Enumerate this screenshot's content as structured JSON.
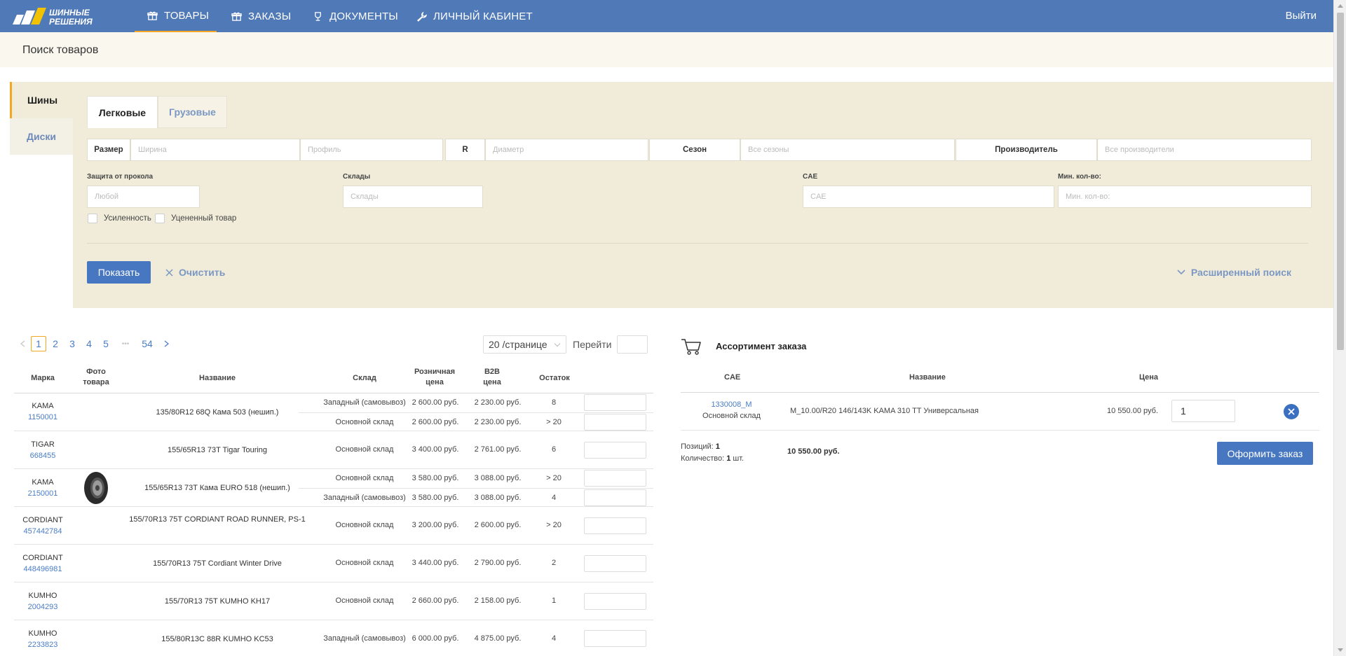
{
  "nav": {
    "logo_text": "ШИННЫЕ РЕШЕНИЯ",
    "items": [
      {
        "label": "ТОВАРЫ",
        "icon": "gift-icon"
      },
      {
        "label": "ЗАКАЗЫ",
        "icon": "gift-icon"
      },
      {
        "label": "ДОКУМЕНТЫ",
        "icon": "trophy-icon"
      },
      {
        "label": "ЛИЧНЫЙ КАБИНЕТ",
        "icon": "wrench-icon"
      }
    ],
    "logout": "Выйти"
  },
  "page": {
    "title": "Поиск товаров"
  },
  "side_tabs": [
    "Шины",
    "Диски"
  ],
  "sub_tabs": [
    "Легковые",
    "Грузовые"
  ],
  "filters": {
    "size_label": "Размер",
    "width_placeholder": "Ширина",
    "profile_placeholder": "Профиль",
    "r_label": "R",
    "diameter_placeholder": "Диаметр",
    "season_label": "Сезон",
    "season_placeholder": "Все сезоны",
    "maker_label": "Производитель",
    "maker_placeholder": "Все производители",
    "puncture_caption": "Защита от прокола",
    "puncture_placeholder": "Любой",
    "warehouses_caption": "Склады",
    "warehouses_placeholder": "Склады",
    "cae_caption": "CAE",
    "cae_placeholder": "CAE",
    "minqty_caption": "Мин. кол-во:",
    "minqty_placeholder": "Мин. кол-во:",
    "reinforced_label": "Усиленность",
    "discounted_label": "Уцененный товар",
    "show_button": "Показать",
    "clear_button": "Очистить",
    "advanced_search": "Расширенный поиск"
  },
  "pagination": {
    "pages": [
      "1",
      "2",
      "3",
      "4",
      "5",
      "•••",
      "54"
    ],
    "current": "1",
    "per_page": "20 /странице",
    "goto_label": "Перейти"
  },
  "table": {
    "headers": {
      "brand": "Марка",
      "photo": "Фото товара",
      "name": "Название",
      "warehouse": "Склад",
      "retail": "Розничная цена",
      "b2b": "B2B цена",
      "stock": "Остаток"
    },
    "rows": [
      {
        "brand": "KAMA",
        "code": "1150001",
        "name": "135/80R12 68Q Кама 503 (нешип.)",
        "photo": false,
        "stocks": [
          {
            "warehouse": "Западный (самовывоз)",
            "retail": "2 600.00 руб.",
            "b2b": "2 230.00 руб.",
            "left": "8"
          },
          {
            "warehouse": "Основной склад",
            "retail": "2 600.00 руб.",
            "b2b": "2 230.00 руб.",
            "left": "> 20"
          }
        ]
      },
      {
        "brand": "TIGAR",
        "code": "668455",
        "name": "155/65R13 73T Tigar Touring",
        "photo": false,
        "stocks": [
          {
            "warehouse": "Основной склад",
            "retail": "3 400.00 руб.",
            "b2b": "2 761.00 руб.",
            "left": "6"
          }
        ]
      },
      {
        "brand": "KAMA",
        "code": "2150001",
        "name": "155/65R13 73T Кама EURO 518 (нешип.)",
        "photo": true,
        "stocks": [
          {
            "warehouse": "Основной склад",
            "retail": "3 580.00 руб.",
            "b2b": "3 088.00 руб.",
            "left": "> 20"
          },
          {
            "warehouse": "Западный (самовывоз)",
            "retail": "3 580.00 руб.",
            "b2b": "3 088.00 руб.",
            "left": "4"
          }
        ]
      },
      {
        "brand": "CORDIANT",
        "code": "457442784",
        "name": "155/70R13 75T CORDIANT ROAD RUNNER, PS-1",
        "photo": false,
        "stocks": [
          {
            "warehouse": "Основной склад",
            "retail": "3 200.00 руб.",
            "b2b": "2 600.00 руб.",
            "left": "> 20"
          }
        ]
      },
      {
        "brand": "CORDIANT",
        "code": "448496981",
        "name": "155/70R13 75T Cordiant Winter Drive",
        "photo": false,
        "stocks": [
          {
            "warehouse": "Основной склад",
            "retail": "3 440.00 руб.",
            "b2b": "2 790.00 руб.",
            "left": "2"
          }
        ]
      },
      {
        "brand": "KUMHO",
        "code": "2004293",
        "name": "155/70R13 75T KUMHO KH17",
        "photo": false,
        "stocks": [
          {
            "warehouse": "Основной склад",
            "retail": "2 660.00 руб.",
            "b2b": "2 158.00 руб.",
            "left": "1"
          }
        ]
      },
      {
        "brand": "KUMHO",
        "code": "2233823",
        "name": "155/80R13C 88R KUMHO KC53",
        "photo": false,
        "stocks": [
          {
            "warehouse": "Западный (самовывоз)",
            "retail": "6 000.00 руб.",
            "b2b": "4 875.00 руб.",
            "left": "4"
          }
        ]
      }
    ]
  },
  "order": {
    "title": "Ассортимент заказа",
    "headers": {
      "code": "CAE",
      "name": "Название",
      "price": "Цена"
    },
    "items": [
      {
        "code": "1330008_M",
        "warehouse": "Основной склад",
        "name": "M_10.00/R20 146/143K KAMA 310 TT Универсальная",
        "price": "10 550.00 руб.",
        "qty": "1"
      }
    ],
    "positions_label": "Позиций:",
    "positions": "1",
    "quantity_label": "Количество:",
    "quantity": "1",
    "quantity_unit": "шт.",
    "total": "10 550.00 руб.",
    "submit": "Оформить заказ"
  },
  "colors": {
    "nav_bg": "#5079b8",
    "accent": "#f5a623",
    "panel_bg": "#f0ecd9",
    "primary_button": "#4777c1",
    "link": "#4a7dc4"
  }
}
